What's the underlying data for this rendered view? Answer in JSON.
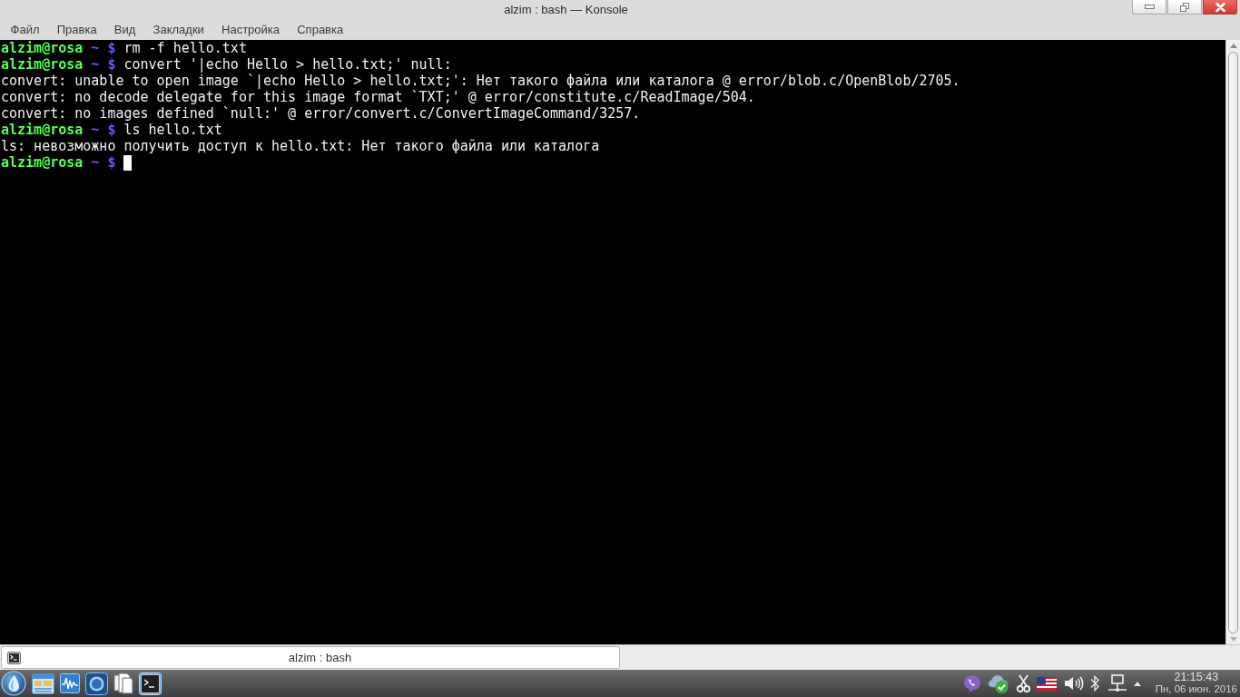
{
  "window": {
    "title": "alzim : bash — Konsole"
  },
  "menu": [
    "Файл",
    "Правка",
    "Вид",
    "Закладки",
    "Настройка",
    "Справка"
  ],
  "terminal": {
    "lines": [
      {
        "kind": "prompt",
        "user": "alzim@rosa",
        "path": "~",
        "symbol": "$",
        "command": "rm -f hello.txt",
        "cursor": false
      },
      {
        "kind": "prompt",
        "user": "alzim@rosa",
        "path": "~",
        "symbol": "$",
        "command": "convert '|echo Hello > hello.txt;' null:",
        "cursor": false
      },
      {
        "kind": "output",
        "text": "convert: unable to open image `|echo Hello > hello.txt;': Нет такого файла или каталога @ error/blob.c/OpenBlob/2705."
      },
      {
        "kind": "output",
        "text": "convert: no decode delegate for this image format `TXT;' @ error/constitute.c/ReadImage/504."
      },
      {
        "kind": "output",
        "text": "convert: no images defined `null:' @ error/convert.c/ConvertImageCommand/3257."
      },
      {
        "kind": "prompt",
        "user": "alzim@rosa",
        "path": "~",
        "symbol": "$",
        "command": "ls hello.txt",
        "cursor": false
      },
      {
        "kind": "output",
        "text": "ls: невозможно получить доступ к hello.txt: Нет такого файла или каталога"
      },
      {
        "kind": "prompt",
        "user": "alzim@rosa",
        "path": "~",
        "symbol": "$",
        "cursor": true
      }
    ]
  },
  "tabs": [
    {
      "label": "alzim : bash",
      "selected": true
    }
  ],
  "taskbar": {
    "clock": {
      "time": "21:15:43",
      "date": "Пн, 06 июн. 2016"
    }
  }
}
